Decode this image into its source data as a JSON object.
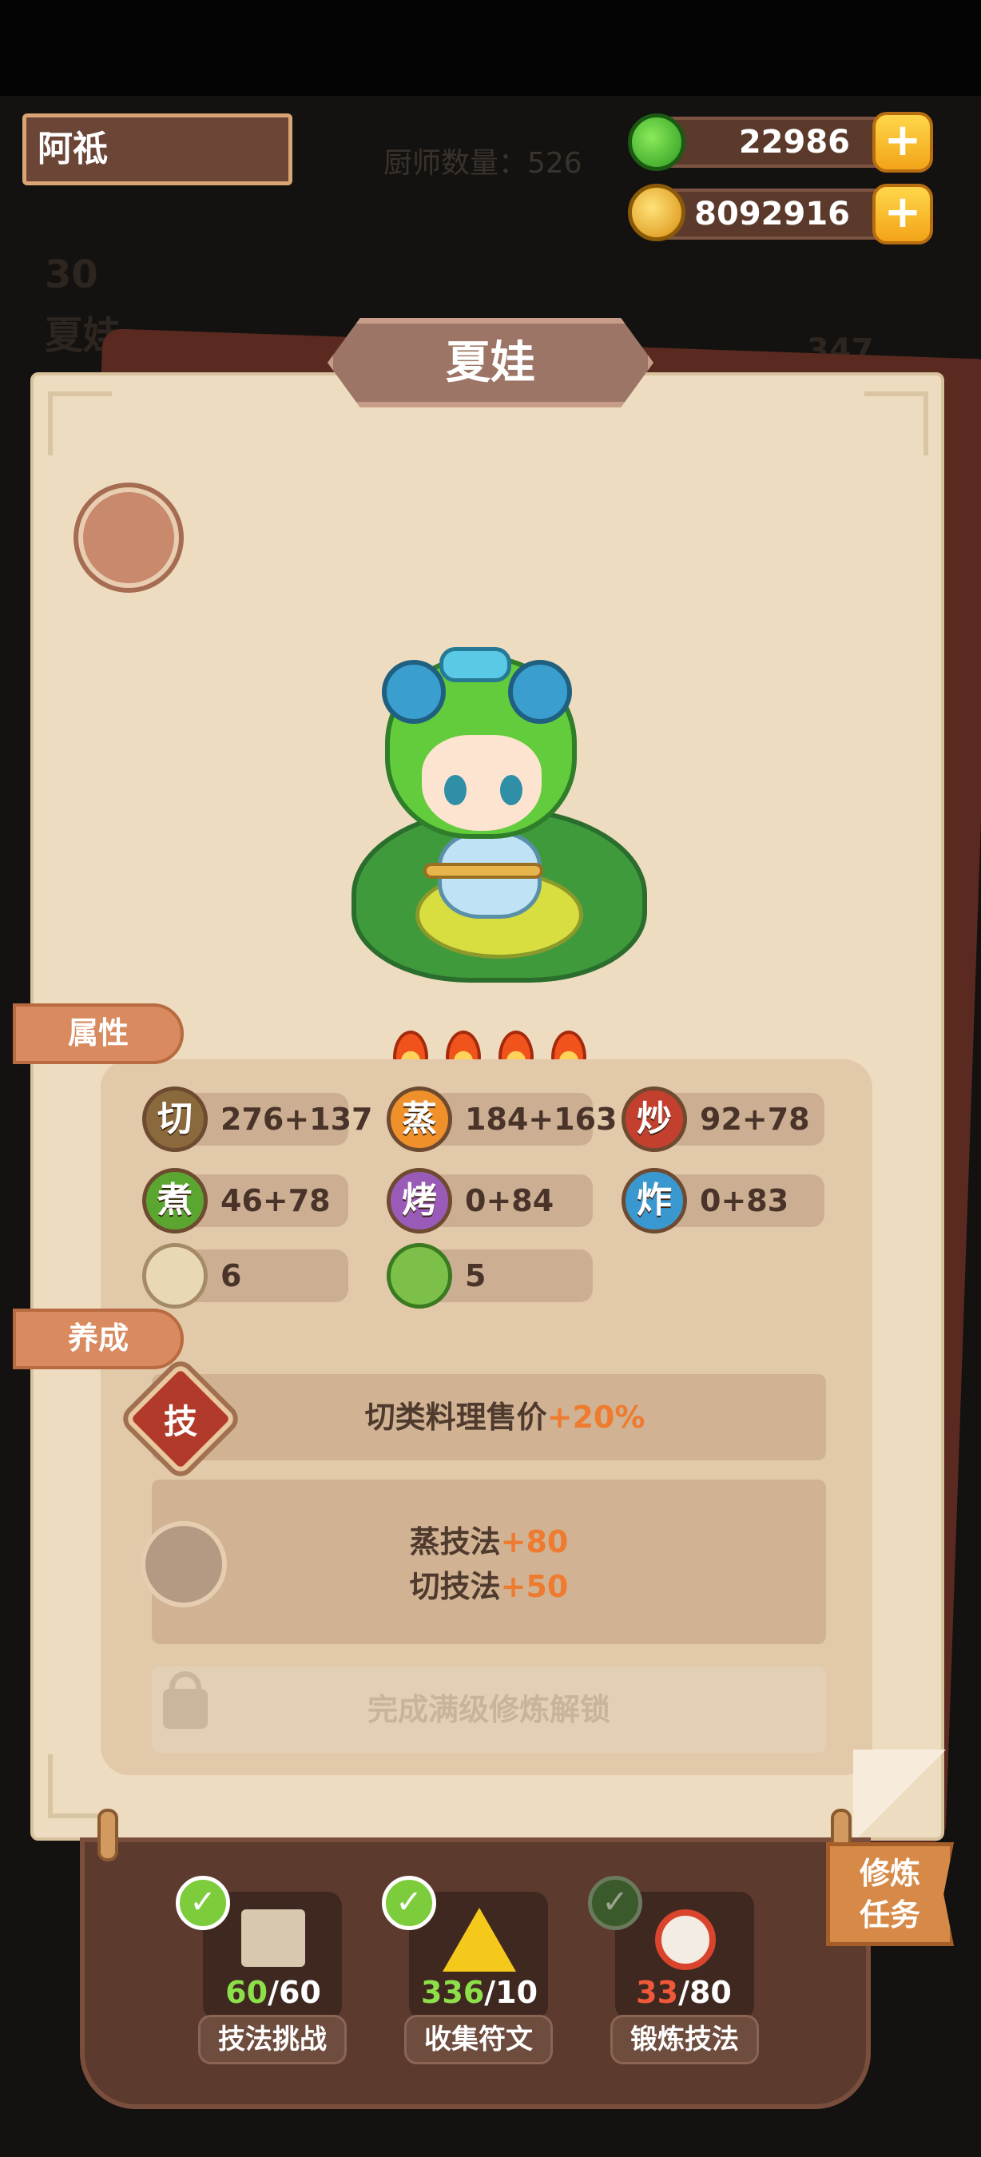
{
  "header": {
    "player_name": "阿祗",
    "chef_count_label": "厨师数量：526"
  },
  "resources": [
    {
      "name": "jade",
      "value": "22986",
      "icon": "jade-coin-icon",
      "color": "#4cc22e"
    },
    {
      "name": "gold",
      "value": "8092916",
      "icon": "gold-coin-icon",
      "color": "#f3b21c"
    }
  ],
  "background_faded": {
    "rarity": "30",
    "chef_name": "夏娃",
    "side_value": "347"
  },
  "chef": {
    "name": "夏娃",
    "stars_flames": 4
  },
  "sections": {
    "attributes": "属性",
    "cultivation": "养成"
  },
  "stats": [
    {
      "icon_char": "切",
      "value": "276+137",
      "color": "#8a6a3c"
    },
    {
      "icon_char": "蒸",
      "value": "184+163",
      "color": "#f0902a"
    },
    {
      "icon_char": "炒",
      "value": "92+78",
      "color": "#c4402e"
    },
    {
      "icon_char": "煮",
      "value": "46+78",
      "color": "#5aa630"
    },
    {
      "icon_char": "烤",
      "value": "0+84",
      "color": "#9a5ab8"
    },
    {
      "icon_char": "炸",
      "value": "0+83",
      "color": "#3a98d0"
    },
    {
      "icon_char": "",
      "value": "6",
      "icon": "steamer-bun-icon",
      "color": "#e9d8b4"
    },
    {
      "icon_char": "",
      "value": "5",
      "icon": "cabbage-icon",
      "color": "#7cc04a"
    }
  ],
  "cultivation": {
    "skill_letter": "技",
    "skill_text": "切类料理售价",
    "skill_bonus": "+20%",
    "cert_line1_text": "蒸技法",
    "cert_line1_bonus": "+80",
    "cert_line2_text": "切技法",
    "cert_line2_bonus": "+50",
    "locked_text": "完成满级修炼解锁"
  },
  "tasks": [
    {
      "current": "60",
      "total": "/60",
      "label": "技法挑战",
      "done": true,
      "count_color": "#8ee04a",
      "icon": "scroll-bundle-icon"
    },
    {
      "current": "336",
      "total": "/10",
      "label": "收集符文",
      "done": true,
      "count_color": "#8ee04a",
      "icon": "rune-triangle-icon"
    },
    {
      "current": "33",
      "total": "/80",
      "label": "锻炼技法",
      "done": false,
      "count_color": "#f0583a",
      "icon": "alarm-clock-icon"
    }
  ],
  "training_task_button": {
    "line1": "修炼",
    "line2": "任务"
  }
}
